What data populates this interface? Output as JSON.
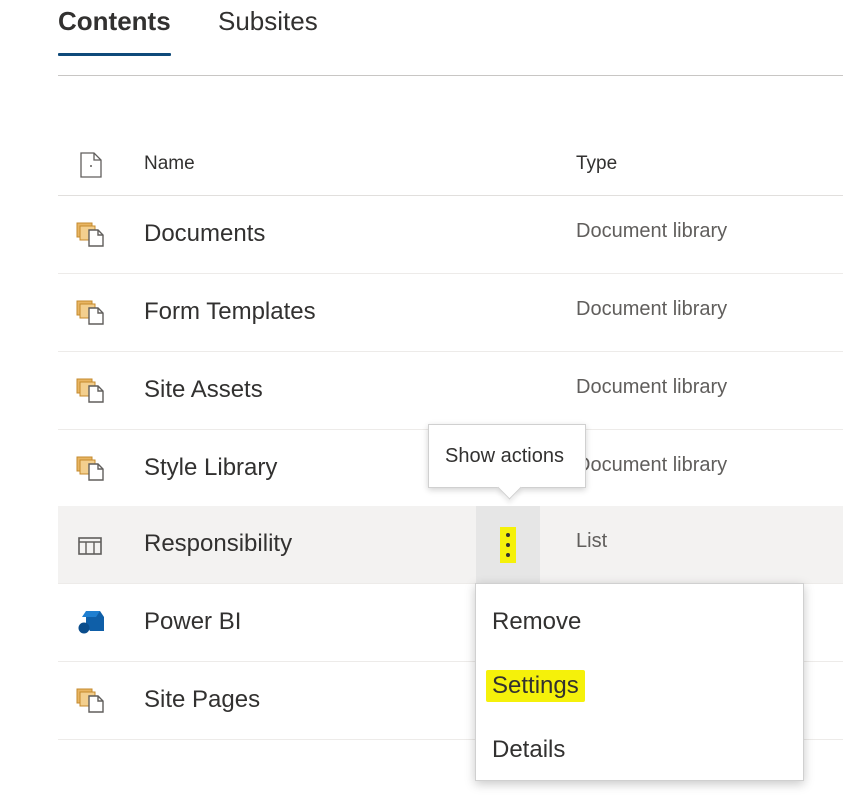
{
  "tabs": [
    {
      "label": "Contents",
      "active": true
    },
    {
      "label": "Subsites",
      "active": false
    }
  ],
  "table": {
    "columns": {
      "name": "Name",
      "type": "Type"
    },
    "rows": [
      {
        "name": "Documents",
        "type": "Document library",
        "icon": "library-icon"
      },
      {
        "name": "Form Templates",
        "type": "Document library",
        "icon": "library-icon"
      },
      {
        "name": "Site Assets",
        "type": "Document library",
        "icon": "library-icon"
      },
      {
        "name": "Style Library",
        "type": "Document library",
        "icon": "library-icon"
      },
      {
        "name": "Responsibility",
        "type": "List",
        "icon": "list-icon"
      },
      {
        "name": "Power BI",
        "type": "",
        "icon": "power-bi-icon"
      },
      {
        "name": "Site Pages",
        "type": "",
        "icon": "library-icon"
      }
    ]
  },
  "tooltip": {
    "text": "Show actions"
  },
  "context_menu": {
    "items": [
      {
        "label": "Remove"
      },
      {
        "label": "Settings"
      },
      {
        "label": "Details"
      }
    ]
  },
  "colors": {
    "accent_underline": "#0f4a7a",
    "highlight": "#f5f10a",
    "hover_row": "#f3f2f1",
    "library_icon": "#e8b563",
    "power_bi_icon": "#0f5fa8"
  }
}
